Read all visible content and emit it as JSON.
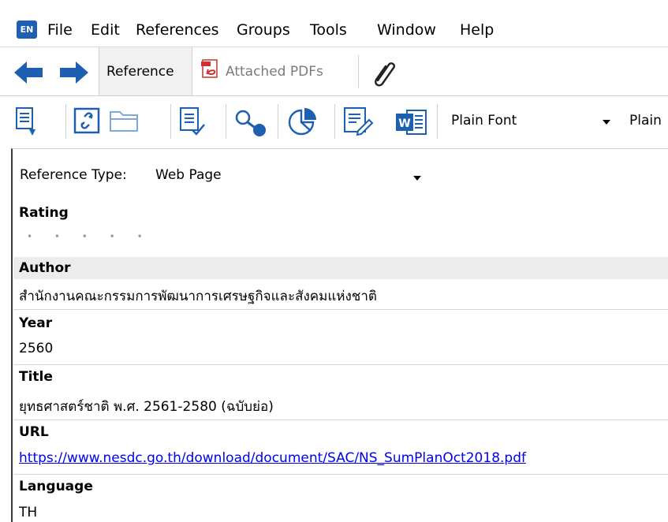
{
  "app": {
    "logo_text": "EN"
  },
  "menu": [
    "File",
    "Edit",
    "References",
    "Groups",
    "Tools",
    "Window",
    "Help"
  ],
  "tabs": {
    "reference": "Reference",
    "attached_pdfs": "Attached PDFs"
  },
  "toolbar": {
    "font": "Plain Font",
    "font_size_partial": "Plain"
  },
  "reference_type": {
    "label": "Reference Type:",
    "value": "Web Page"
  },
  "fields": {
    "rating": {
      "label": "Rating",
      "dots": "• • • • •"
    },
    "author": {
      "label": "Author",
      "value": "สำนักงานคณะกรรมการพัฒนาการเศรษฐกิจและสังคมแห่งชาติ"
    },
    "year": {
      "label": "Year",
      "value": "2560"
    },
    "title": {
      "label": "Title",
      "value": "ยุทธศาสตร์ชาติ พ.ศ. 2561-2580 (ฉบับย่อ)"
    },
    "url": {
      "label": "URL",
      "value": "https://www.nesdc.go.th/download/document/SAC/NS_SumPlanOct2018.pdf"
    },
    "language": {
      "label": "Language",
      "value": "TH"
    }
  },
  "colors": {
    "accent_blue": "#1d5fb0",
    "link": "#0000ee",
    "pdf_red": "#d32f2f"
  }
}
